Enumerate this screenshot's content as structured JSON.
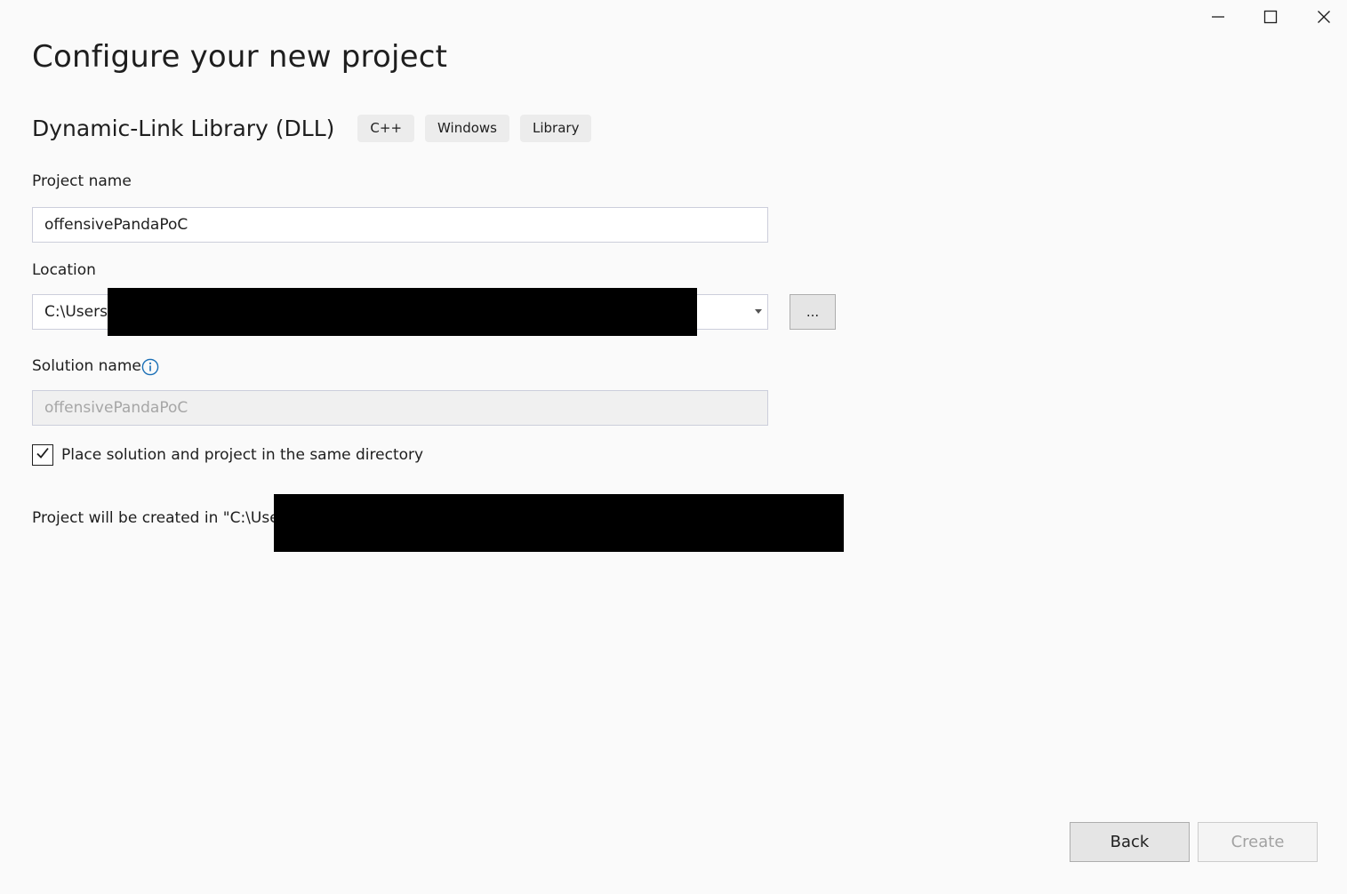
{
  "window_controls": {
    "minimize": "minimize-icon",
    "maximize": "maximize-icon",
    "close": "close-icon"
  },
  "page_title": "Configure your new project",
  "template": {
    "name": "Dynamic-Link Library (DLL)",
    "tags": [
      "C++",
      "Windows",
      "Library"
    ]
  },
  "project_name": {
    "label": "Project name",
    "value": "offensivePandaPoC"
  },
  "location": {
    "label": "Location",
    "value": "C:\\Users\\",
    "browse_label": "..."
  },
  "solution_name": {
    "label": "Solution name",
    "value": "offensivePandaPoC",
    "info_icon": "info-icon"
  },
  "same_directory": {
    "label": "Place solution and project in the same directory",
    "checked": true
  },
  "created_in_text": "Project will be created in \"C:\\Users\\",
  "footer": {
    "back_label": "Back",
    "create_label": "Create"
  },
  "colors": {
    "background": "#fafafa",
    "info_accent": "#1a6fb6",
    "redaction": "#000000"
  }
}
